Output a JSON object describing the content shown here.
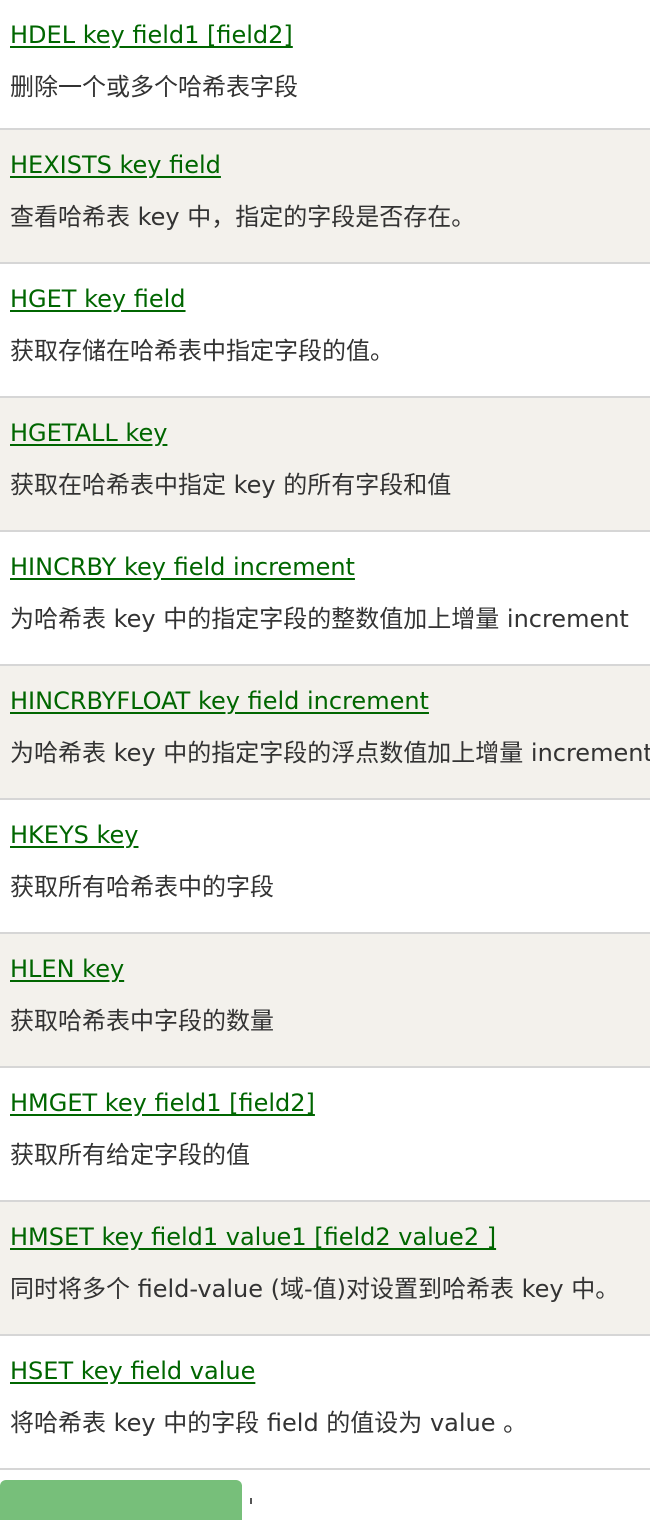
{
  "commands": [
    {
      "name": "HDEL key field1 [field2]",
      "desc": "删除一个或多个哈希表字段"
    },
    {
      "name": "HEXISTS key field",
      "desc": "查看哈希表 key 中，指定的字段是否存在。"
    },
    {
      "name": "HGET key field",
      "desc": "获取存储在哈希表中指定字段的值。"
    },
    {
      "name": "HGETALL key",
      "desc": "获取在哈希表中指定 key 的所有字段和值"
    },
    {
      "name": "HINCRBY key field increment",
      "desc": "为哈希表 key 中的指定字段的整数值加上增量 increment"
    },
    {
      "name": "HINCRBYFLOAT key field increment",
      "desc": "为哈希表 key 中的指定字段的浮点数值加上增量 increment"
    },
    {
      "name": "HKEYS key",
      "desc": "获取所有哈希表中的字段"
    },
    {
      "name": "HLEN key",
      "desc": "获取哈希表中字段的数量"
    },
    {
      "name": "HMGET key field1 [field2]",
      "desc": "获取所有给定字段的值"
    },
    {
      "name": "HMSET key field1 value1 [field2 value2 ]",
      "desc": "同时将多个 field-value (域-值)对设置到哈希表 key 中。"
    },
    {
      "name": "HSET key field value",
      "desc": "将哈希表 key 中的字段 field 的值设为 value 。"
    }
  ],
  "colors": {
    "link": "#006600",
    "text": "#333333",
    "row_alt": "#f3f1ec",
    "divider": "#d6d6d6",
    "button": "#77bf7a"
  }
}
